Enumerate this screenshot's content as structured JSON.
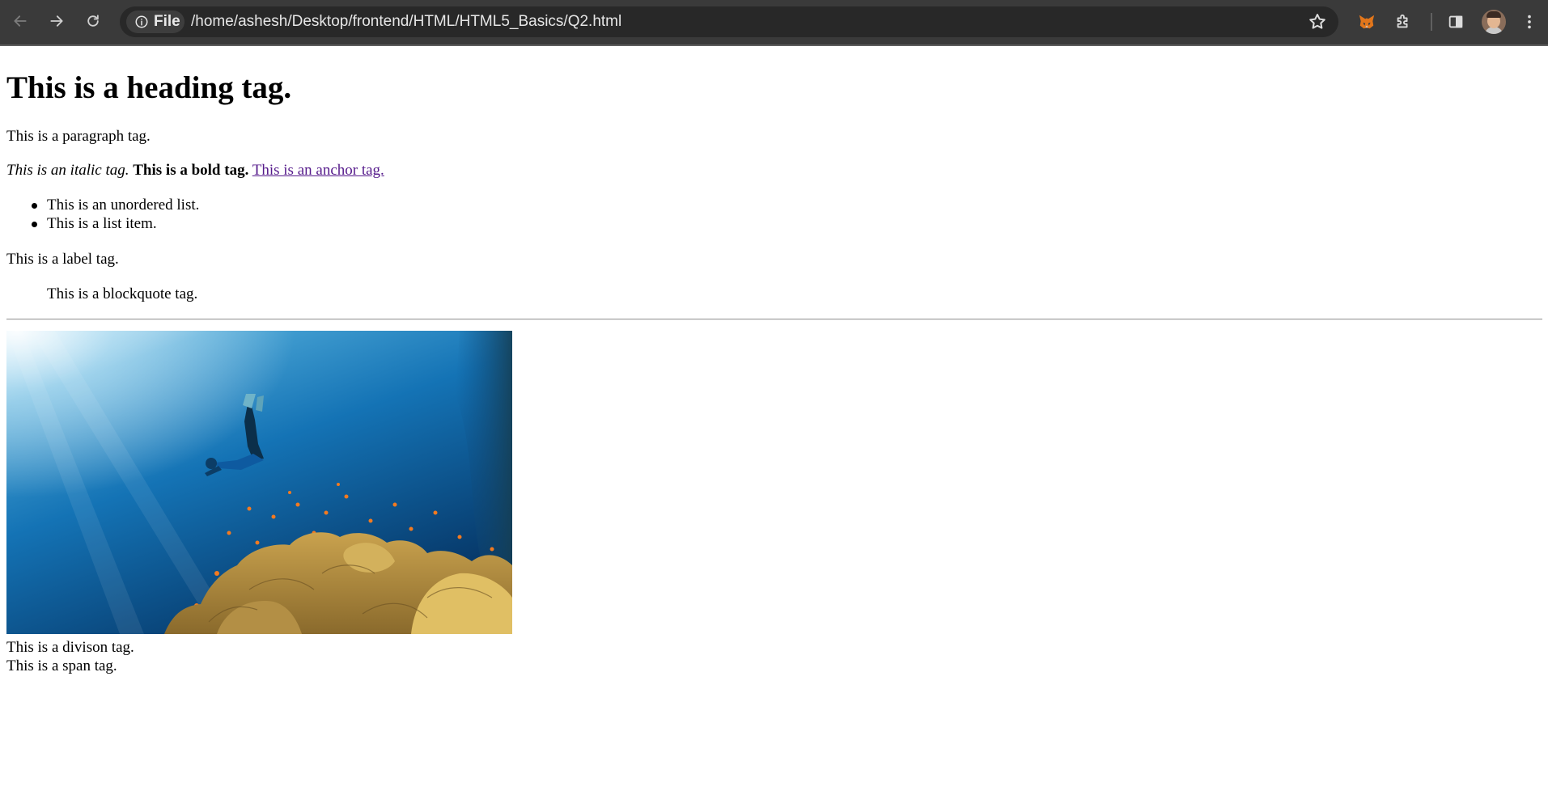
{
  "browser": {
    "scheme_chip": "File",
    "url": "/home/ashesh/Desktop/frontend/HTML/HTML5_Basics/Q2.html",
    "icons": {
      "back": "arrow-left-icon",
      "forward": "arrow-right-icon",
      "reload": "reload-icon",
      "info": "info-icon",
      "bookmark": "star-icon",
      "extension_1": "metamask-fox-icon",
      "extensions": "puzzle-icon",
      "side_panel": "side-panel-icon",
      "profile": "avatar",
      "menu": "kebab-menu-icon"
    },
    "colors": {
      "toolbar_bg": "#3a3a3a",
      "omnibox_bg": "#282828",
      "text": "#e6e6e6"
    }
  },
  "page": {
    "heading": "This is a heading tag.",
    "paragraph": "This is a paragraph tag.",
    "italic": "This is an italic tag.",
    "bold": "This is a bold tag.",
    "anchor": "This is an anchor tag.",
    "list_items": [
      "This is an unordered list.",
      "This is a list item."
    ],
    "label": "This is a label tag.",
    "blockquote": "This is a blockquote tag.",
    "image": "underwater-freediver-coral-reef-image",
    "division": "This is a divison tag.",
    "span": "This is a span tag.",
    "colors": {
      "visited_link": "#551a8b",
      "text": "#000000",
      "background": "#ffffff"
    }
  }
}
